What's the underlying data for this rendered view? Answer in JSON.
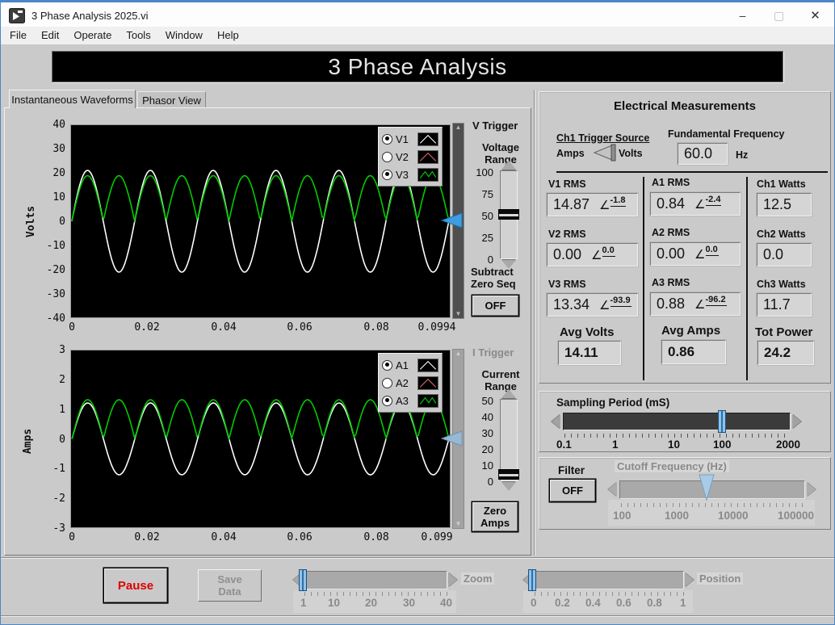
{
  "window": {
    "title": "3 Phase Analysis 2025.vi",
    "minimize": "–",
    "maximize": "▢",
    "close": "✕"
  },
  "menu": {
    "items": [
      "File",
      "Edit",
      "Operate",
      "Tools",
      "Window",
      "Help"
    ]
  },
  "banner": {
    "title": "3 Phase Analysis"
  },
  "tabs": [
    {
      "label": "Instantaneous Waveforms",
      "active": true
    },
    {
      "label": "Phasor View",
      "active": false
    }
  ],
  "v_trigger": {
    "title": "V Trigger",
    "range_label": "Voltage Range",
    "scale": [
      "100",
      "75",
      "50",
      "25",
      "0"
    ],
    "subtract_label": "Subtract Zero Seq",
    "off_label": "OFF"
  },
  "i_trigger": {
    "title": "I Trigger",
    "range_label": "Current Range",
    "scale": [
      "50",
      "40",
      "30",
      "20",
      "10",
      "0"
    ],
    "zero_label": "Zero Amps"
  },
  "measurements": {
    "title": "Electrical Measurements",
    "trigger_source": {
      "label": "Ch1 Trigger Source",
      "left": "Amps",
      "right": "Volts"
    },
    "fundamental": {
      "label": "Fundamental Frequency",
      "value": "60.0",
      "unit": "Hz"
    },
    "rows": [
      {
        "v_label": "V1 RMS",
        "v_value": "14.87",
        "v_angle": "-1.8",
        "a_label": "A1 RMS",
        "a_value": "0.84",
        "a_angle": "-2.4",
        "w_label": "Ch1 Watts",
        "w_value": "12.5"
      },
      {
        "v_label": "V2 RMS",
        "v_value": "0.00",
        "v_angle": "0.0",
        "a_label": "A2 RMS",
        "a_value": "0.00",
        "a_angle": "0.0",
        "w_label": "Ch2 Watts",
        "w_value": "0.0"
      },
      {
        "v_label": "V3 RMS",
        "v_value": "13.34",
        "v_angle": "-93.9",
        "a_label": "A3 RMS",
        "a_value": "0.88",
        "a_angle": "-96.2",
        "w_label": "Ch3 Watts",
        "w_value": "11.7"
      }
    ],
    "averages": {
      "volts_label": "Avg Volts",
      "volts": "14.11",
      "amps_label": "Avg Amps",
      "amps": "0.86",
      "power_label": "Tot Power",
      "power": "24.2"
    }
  },
  "sampling": {
    "label": "Sampling Period (mS)",
    "scale": [
      "0.1",
      "1",
      "10",
      "100",
      "2000"
    ],
    "value": "100"
  },
  "filter": {
    "label": "Filter",
    "off_label": "OFF",
    "cutoff_label": "Cutoff Frequency (Hz)",
    "scale": [
      "100",
      "1000",
      "10000",
      "100000"
    ]
  },
  "footer": {
    "pause_label": "Pause",
    "save_label": "Save Data",
    "zoom_label": "Zoom",
    "zoom_scale": [
      "1",
      "10",
      "20",
      "30",
      "40"
    ],
    "zoom_value": "1",
    "position_label": "Position",
    "position_scale": [
      "0",
      "0.2",
      "0.4",
      "0.6",
      "0.8",
      "1"
    ],
    "position_value": "0"
  },
  "chart_data": [
    {
      "type": "line",
      "title": "Instantaneous Volts",
      "ylabel": "Volts",
      "xlim": [
        0,
        0.0994
      ],
      "ylim": [
        -40,
        40
      ],
      "grid": false,
      "legend_position": "top-right",
      "xticks": [
        "0",
        "0.02",
        "0.04",
        "0.06",
        "0.08",
        "0.0994"
      ],
      "yticks": [
        "40",
        "30",
        "20",
        "10",
        "0",
        "-10",
        "-20",
        "-30",
        "-40"
      ],
      "series": [
        {
          "name": "V1",
          "color": "#ffffff",
          "selected": true,
          "visible": true,
          "waveform": "sine",
          "amplitude": 21.2,
          "frequency_hz": 60.4,
          "phase_deg": 0
        },
        {
          "name": "V2",
          "color": "#d96a6a",
          "selected": false,
          "visible": false,
          "waveform": "sine",
          "amplitude": 0,
          "frequency_hz": 60,
          "phase_deg": 0
        },
        {
          "name": "V3",
          "color": "#00cc00",
          "selected": true,
          "visible": true,
          "waveform": "rectified-sine",
          "amplitude": 19.0,
          "frequency_hz": 60.4,
          "phase_deg": 0
        }
      ]
    },
    {
      "type": "line",
      "title": "Instantaneous Amps",
      "ylabel": "Amps",
      "xlim": [
        0,
        0.099
      ],
      "ylim": [
        -3,
        3
      ],
      "grid": false,
      "legend_position": "top-right",
      "xticks": [
        "0",
        "0.02",
        "0.04",
        "0.06",
        "0.08",
        "0.099"
      ],
      "yticks": [
        "3",
        "2",
        "1",
        "0",
        "-1",
        "-2",
        "-3"
      ],
      "series": [
        {
          "name": "A1",
          "color": "#ffffff",
          "selected": true,
          "visible": true,
          "waveform": "sine",
          "amplitude": 1.22,
          "frequency_hz": 60.6,
          "phase_deg": 0
        },
        {
          "name": "A2",
          "color": "#d96a6a",
          "selected": false,
          "visible": false,
          "waveform": "sine",
          "amplitude": 0,
          "frequency_hz": 60,
          "phase_deg": 0
        },
        {
          "name": "A3",
          "color": "#00cc00",
          "selected": true,
          "visible": true,
          "waveform": "rectified-sine",
          "amplitude": 1.33,
          "frequency_hz": 60.6,
          "phase_deg": 0
        }
      ]
    }
  ]
}
